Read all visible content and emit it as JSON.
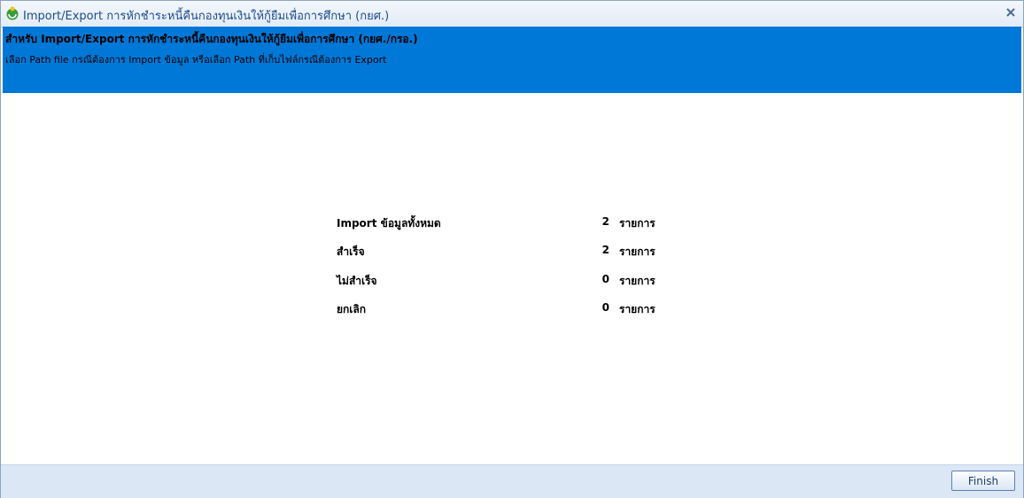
{
  "window": {
    "title": "Import/Export การหักชำระหนี้คืนกองทุนเงินให้กู้ยืมเพื่อการศึกษา (กยศ.)",
    "app_icon": "app-logo-icon",
    "close_icon": "close-icon"
  },
  "banner": {
    "title": "สำหรับ Import/Export การหักชำระหนี้คืนกองทุนเงินให้กู้ยืมเพื่อการศึกษา (กยศ./กรอ.)",
    "description": "เลือก Path file กรณีต้องการ Import ข้อมูล หรือเลือก Path ที่เก็บไฟล์กรณีต้องการ Export",
    "color": "#0078d7"
  },
  "summary": [
    {
      "label": "Import ข้อมูลทั้งหมด",
      "value": "2",
      "unit": "รายการ"
    },
    {
      "label": "สำเร็จ",
      "value": "2",
      "unit": "รายการ"
    },
    {
      "label": "ไม่สำเร็จ",
      "value": "0",
      "unit": "รายการ"
    },
    {
      "label": "ยกเลิก",
      "value": "0",
      "unit": "รายการ"
    }
  ],
  "footer": {
    "finish_label": "Finish"
  }
}
